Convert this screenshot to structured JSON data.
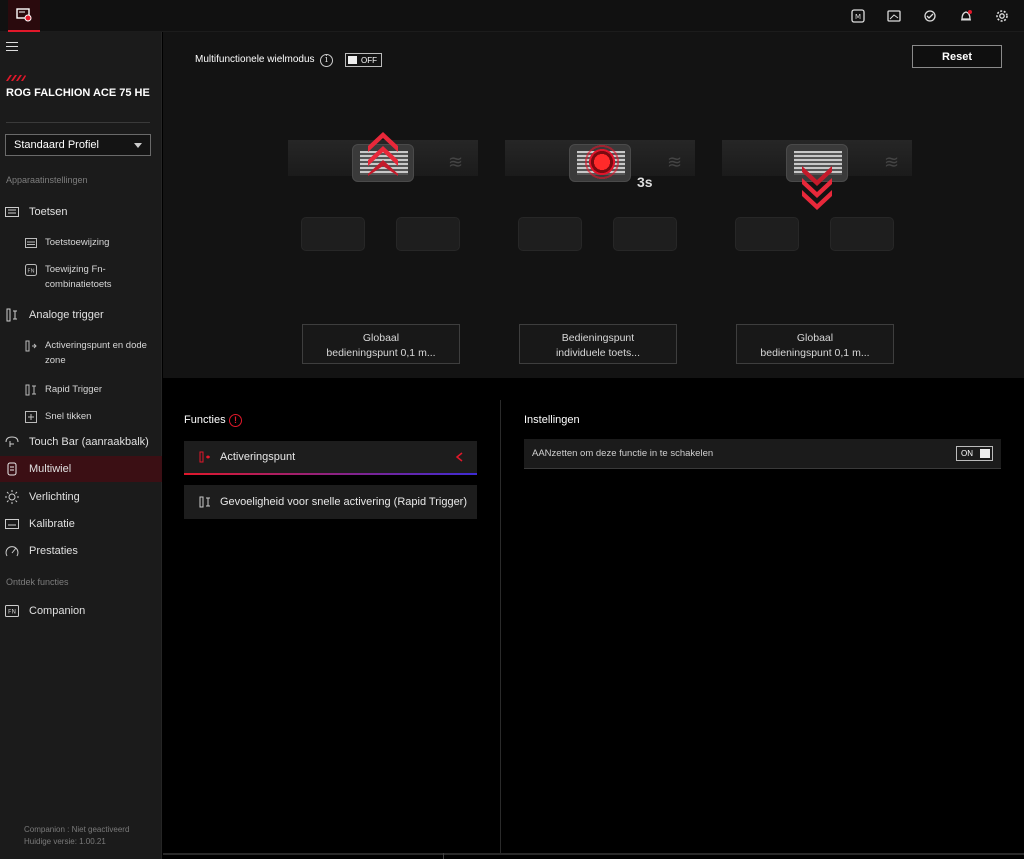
{
  "topbar": {
    "icons": [
      "device-icon",
      "keyboard-icon",
      "display-icon",
      "sync-icon",
      "bell-icon",
      "gear-icon"
    ]
  },
  "sidebar": {
    "device_name": "ROG FALCHION ACE 75 HE",
    "profile": "Standaard Profiel",
    "section_device": "Apparaatinstellingen",
    "section_discover": "Ontdek functies",
    "items": [
      {
        "label": "Toetsen",
        "icon": "keyboard-icon"
      },
      {
        "label": "Analoge trigger",
        "icon": "trigger-icon"
      },
      {
        "label": "Touch Bar (aanraakbalk)",
        "icon": "touch-bar-icon"
      },
      {
        "label": "Multiwiel",
        "icon": "wheel-icon"
      },
      {
        "label": "Verlichting",
        "icon": "lighting-icon"
      },
      {
        "label": "Kalibratie",
        "icon": "calibration-icon"
      },
      {
        "label": "Prestaties",
        "icon": "performance-icon"
      },
      {
        "label": "Companion",
        "icon": "companion-icon"
      }
    ],
    "sub_items": [
      {
        "label": "Toetstoewijzing"
      },
      {
        "label": "Toewijzing Fn-combinatietoets"
      },
      {
        "label": "Activeringspunt en dode zone"
      },
      {
        "label": "Rapid Trigger"
      },
      {
        "label": "Snel tikken"
      }
    ],
    "version_line1": "Companion : Niet geactiveerd",
    "version_line2": "Huidige versie: 1.00.21"
  },
  "main": {
    "wheel_mode_label": "Multifunctionele wielmodus",
    "wheel_mode_toggle": "OFF",
    "reset_label": "Reset",
    "hold_label": "3s",
    "cards": [
      {
        "line1": "Globaal",
        "line2": "bedieningspunt 0,1 m..."
      },
      {
        "line1": "Bedieningspunt",
        "line2": "individuele toets..."
      },
      {
        "line1": "Globaal",
        "line2": "bedieningspunt 0,1 m..."
      }
    ]
  },
  "functions": {
    "title": "Functies",
    "items": [
      {
        "label": "Activeringspunt"
      },
      {
        "label": "Gevoeligheid voor snelle activering (Rapid Trigger)"
      }
    ]
  },
  "settings": {
    "title": "Instellingen",
    "row_label": "AANzetten om deze functie in te schakelen",
    "toggle": "ON"
  },
  "colors": {
    "accent": "#e1182a",
    "accent_blue": "#3d2bd6"
  }
}
